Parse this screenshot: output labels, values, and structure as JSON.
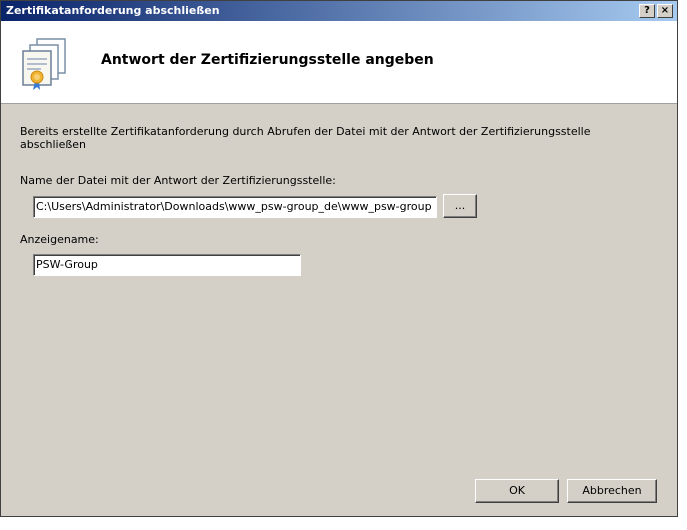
{
  "window": {
    "title": "Zertifikatanforderung abschließen",
    "help_label": "?",
    "close_label": "×"
  },
  "header": {
    "title": "Antwort der Zertifizierungsstelle angeben",
    "icon": "certificates-icon"
  },
  "content": {
    "description": "Bereits erstellte Zertifikatanforderung durch Abrufen der Datei mit der Antwort der Zertifizierungsstelle abschließen",
    "file_label": "Name der Datei mit der Antwort der Zertifizierungsstelle:",
    "file_value": "C:\\Users\\Administrator\\Downloads\\www_psw-group_de\\www_psw-group",
    "browse_label": "...",
    "name_label": "Anzeigename:",
    "name_value": "PSW-Group"
  },
  "buttons": {
    "ok": "OK",
    "cancel": "Abbrechen"
  },
  "colors": {
    "title_start": "#0a246a",
    "title_end": "#a6caf0",
    "dialog_bg": "#d4d0c8"
  }
}
